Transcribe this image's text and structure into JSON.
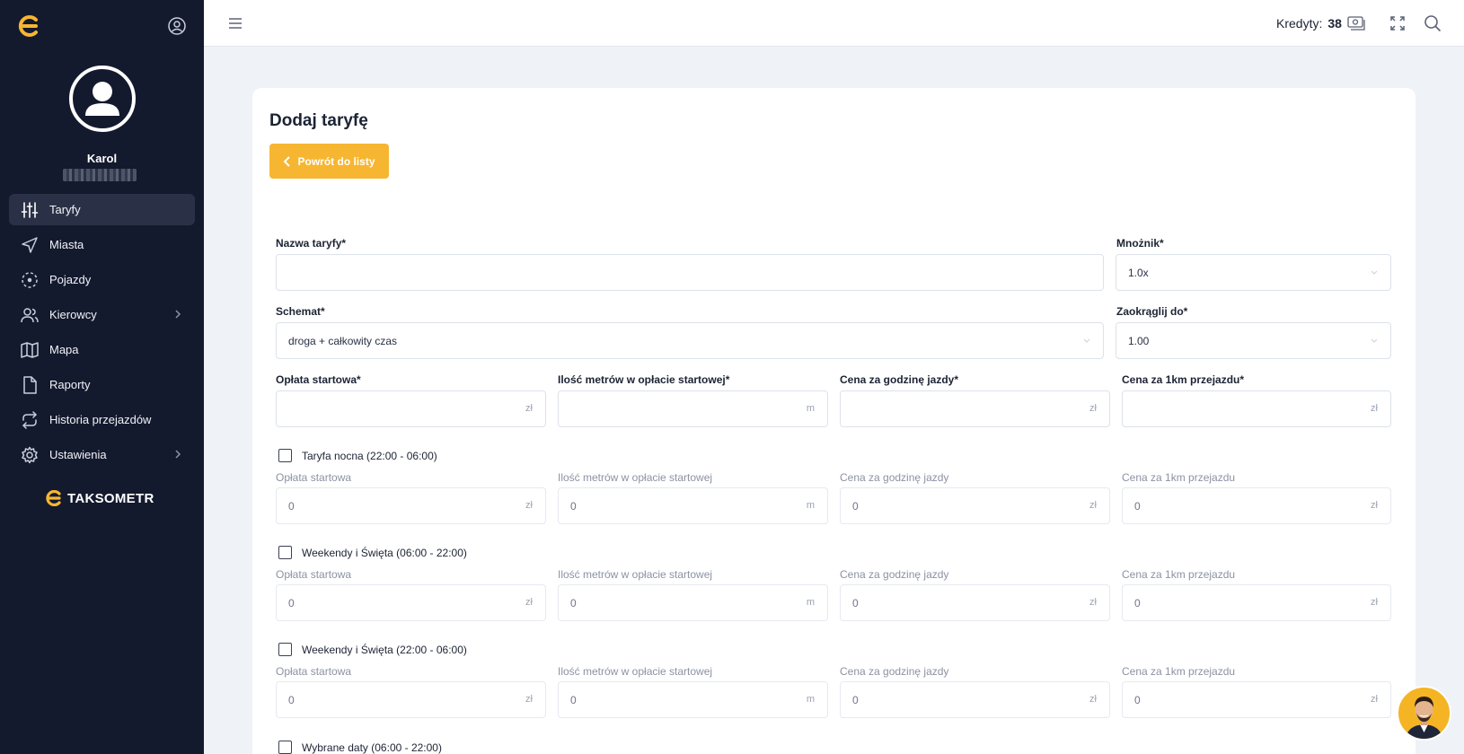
{
  "sidebar": {
    "user_name": "Karol",
    "items": [
      {
        "label": "Taryfy",
        "icon": "sliders-icon",
        "active": true
      },
      {
        "label": "Miasta",
        "icon": "send-icon"
      },
      {
        "label": "Pojazdy",
        "icon": "target-icon"
      },
      {
        "label": "Kierowcy",
        "icon": "users-icon",
        "submenu": true
      },
      {
        "label": "Mapa",
        "icon": "map-icon"
      },
      {
        "label": "Raporty",
        "icon": "file-icon"
      },
      {
        "label": "Historia przejazdów",
        "icon": "repeat-icon"
      },
      {
        "label": "Ustawienia",
        "icon": "gear-icon",
        "submenu": true
      }
    ],
    "brand": "TAKSOMETR"
  },
  "topbar": {
    "credits_label": "Kredyty:",
    "credits_value": "38"
  },
  "page": {
    "title": "Dodaj taryfę",
    "back_button": "Powrót do listy"
  },
  "form": {
    "name_label": "Nazwa taryfy*",
    "name_value": "",
    "multiplier_label": "Mnożnik*",
    "multiplier_value": "1.0x",
    "scheme_label": "Schemat*",
    "scheme_value": "droga + całkowity czas",
    "round_label": "Zaokrąglij do*",
    "round_value": "1.00",
    "base": {
      "start_fee_label": "Opłata startowa*",
      "meters_label": "Ilość metrów w opłacie startowej*",
      "hour_label": "Cena za godzinę jazdy*",
      "km_label": "Cena za 1km przejazdu*",
      "unit_currency": "zł",
      "unit_meters": "m"
    },
    "sections": [
      {
        "checkbox": "Taryfa nocna (22:00 - 06:00)",
        "start_fee_label": "Opłata startowa",
        "meters_label": "Ilość metrów w opłacie startowej",
        "hour_label": "Cena za godzinę jazdy",
        "km_label": "Cena za 1km przejazdu",
        "start_fee": "0",
        "meters": "0",
        "hour": "0",
        "km": "0"
      },
      {
        "checkbox": "Weekendy i Święta (06:00 - 22:00)",
        "start_fee_label": "Opłata startowa",
        "meters_label": "Ilość metrów w opłacie startowej",
        "hour_label": "Cena za godzinę jazdy",
        "km_label": "Cena za 1km przejazdu",
        "start_fee": "0",
        "meters": "0",
        "hour": "0",
        "km": "0"
      },
      {
        "checkbox": "Weekendy i Święta (22:00 - 06:00)",
        "start_fee_label": "Opłata startowa",
        "meters_label": "Ilość metrów w opłacie startowej",
        "hour_label": "Cena za godzinę jazdy",
        "km_label": "Cena za 1km przejazdu",
        "start_fee": "0",
        "meters": "0",
        "hour": "0",
        "km": "0"
      },
      {
        "checkbox": "Wybrane daty (06:00 - 22:00)"
      }
    ]
  },
  "colors": {
    "sidebar_bg": "#141a2e",
    "accent": "#f7b631",
    "page_bg": "#eff2f7"
  }
}
